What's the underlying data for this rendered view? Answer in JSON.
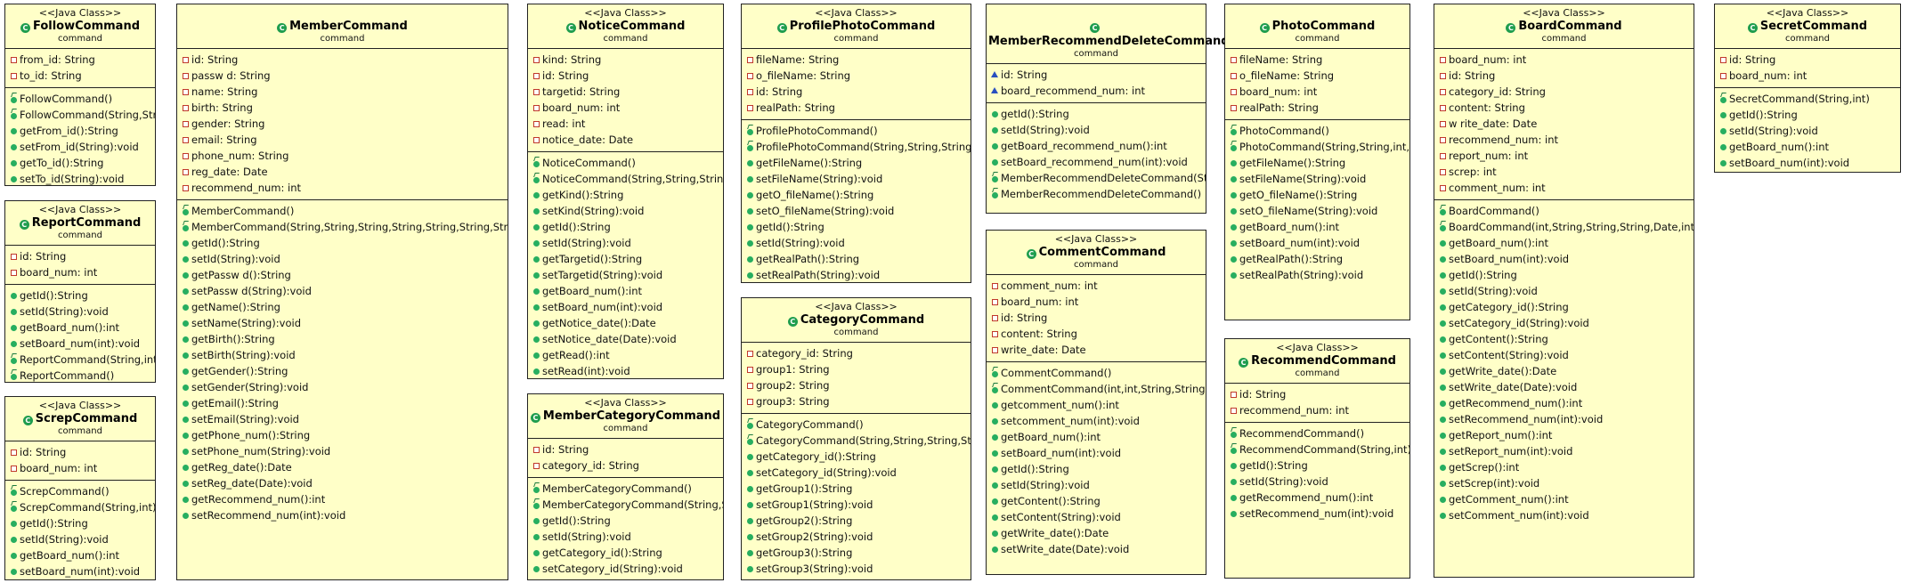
{
  "classes": [
    {
      "id": "follow",
      "stereotype": "<<Java Class>>",
      "name": "FollowCommand",
      "package": "command",
      "attributes": [
        {
          "text": "from_id: String",
          "vis": "private"
        },
        {
          "text": "to_id: String",
          "vis": "private"
        }
      ],
      "methods": [
        {
          "text": "FollowCommand()",
          "kind": "ctor"
        },
        {
          "text": "FollowCommand(String,String)",
          "kind": "ctor"
        },
        {
          "text": "getFrom_id():String",
          "kind": "public"
        },
        {
          "text": "setFrom_id(String):void",
          "kind": "public"
        },
        {
          "text": "getTo_id():String",
          "kind": "public"
        },
        {
          "text": "setTo_id(String):void",
          "kind": "public"
        }
      ]
    },
    {
      "id": "report",
      "stereotype": "<<Java Class>>",
      "name": "ReportCommand",
      "package": "command",
      "attributes": [
        {
          "text": "id: String",
          "vis": "private"
        },
        {
          "text": "board_num: int",
          "vis": "private"
        }
      ],
      "methods": [
        {
          "text": "getId():String",
          "kind": "public"
        },
        {
          "text": "setId(String):void",
          "kind": "public"
        },
        {
          "text": "getBoard_num():int",
          "kind": "public"
        },
        {
          "text": "setBoard_num(int):void",
          "kind": "public"
        },
        {
          "text": "ReportCommand(String,int)",
          "kind": "ctor"
        },
        {
          "text": "ReportCommand()",
          "kind": "ctor"
        }
      ]
    },
    {
      "id": "screp",
      "stereotype": "<<Java Class>>",
      "name": "ScrepCommand",
      "package": "command",
      "attributes": [
        {
          "text": "id: String",
          "vis": "private"
        },
        {
          "text": "board_num: int",
          "vis": "private"
        }
      ],
      "methods": [
        {
          "text": "ScrepCommand()",
          "kind": "ctor"
        },
        {
          "text": "ScrepCommand(String,int)",
          "kind": "ctor"
        },
        {
          "text": "getId():String",
          "kind": "public"
        },
        {
          "text": "setId(String):void",
          "kind": "public"
        },
        {
          "text": "getBoard_num():int",
          "kind": "public"
        },
        {
          "text": "setBoard_num(int):void",
          "kind": "public"
        }
      ]
    },
    {
      "id": "member",
      "stereotype": "",
      "name": "MemberCommand",
      "package": "command",
      "attributes": [
        {
          "text": "id: String",
          "vis": "private"
        },
        {
          "text": "passw d: String",
          "vis": "private"
        },
        {
          "text": "name: String",
          "vis": "private"
        },
        {
          "text": "birth: String",
          "vis": "private"
        },
        {
          "text": "gender: String",
          "vis": "private"
        },
        {
          "text": "email: String",
          "vis": "private"
        },
        {
          "text": "phone_num: String",
          "vis": "private"
        },
        {
          "text": "reg_date: Date",
          "vis": "private"
        },
        {
          "text": "recommend_num: int",
          "vis": "private"
        }
      ],
      "methods": [
        {
          "text": "MemberCommand()",
          "kind": "ctor"
        },
        {
          "text": "MemberCommand(String,String,String,String,String,String,String,Date,int)",
          "kind": "ctor"
        },
        {
          "text": "getId():String",
          "kind": "public"
        },
        {
          "text": "setId(String):void",
          "kind": "public"
        },
        {
          "text": "getPassw d():String",
          "kind": "public"
        },
        {
          "text": "setPassw d(String):void",
          "kind": "public"
        },
        {
          "text": "getName():String",
          "kind": "public"
        },
        {
          "text": "setName(String):void",
          "kind": "public"
        },
        {
          "text": "getBirth():String",
          "kind": "public"
        },
        {
          "text": "setBirth(String):void",
          "kind": "public"
        },
        {
          "text": "getGender():String",
          "kind": "public"
        },
        {
          "text": "setGender(String):void",
          "kind": "public"
        },
        {
          "text": "getEmail():String",
          "kind": "public"
        },
        {
          "text": "setEmail(String):void",
          "kind": "public"
        },
        {
          "text": "getPhone_num():String",
          "kind": "public"
        },
        {
          "text": "setPhone_num(String):void",
          "kind": "public"
        },
        {
          "text": "getReg_date():Date",
          "kind": "public"
        },
        {
          "text": "setReg_date(Date):void",
          "kind": "public"
        },
        {
          "text": "getRecommend_num():int",
          "kind": "public"
        },
        {
          "text": "setRecommend_num(int):void",
          "kind": "public"
        }
      ]
    },
    {
      "id": "notice",
      "stereotype": "<<Java Class>>",
      "name": "NoticeCommand",
      "package": "command",
      "attributes": [
        {
          "text": "kind: String",
          "vis": "private"
        },
        {
          "text": "id: String",
          "vis": "private"
        },
        {
          "text": "targetid: String",
          "vis": "private"
        },
        {
          "text": "board_num: int",
          "vis": "private"
        },
        {
          "text": "read: int",
          "vis": "private"
        },
        {
          "text": "notice_date: Date",
          "vis": "private"
        }
      ],
      "methods": [
        {
          "text": "NoticeCommand()",
          "kind": "ctor"
        },
        {
          "text": "NoticeCommand(String,String,String,int)",
          "kind": "ctor"
        },
        {
          "text": "getKind():String",
          "kind": "public"
        },
        {
          "text": "setKind(String):void",
          "kind": "public"
        },
        {
          "text": "getId():String",
          "kind": "public"
        },
        {
          "text": "setId(String):void",
          "kind": "public"
        },
        {
          "text": "getTargetid():String",
          "kind": "public"
        },
        {
          "text": "setTargetid(String):void",
          "kind": "public"
        },
        {
          "text": "getBoard_num():int",
          "kind": "public"
        },
        {
          "text": "setBoard_num(int):void",
          "kind": "public"
        },
        {
          "text": "getNotice_date():Date",
          "kind": "public"
        },
        {
          "text": "setNotice_date(Date):void",
          "kind": "public"
        },
        {
          "text": "getRead():int",
          "kind": "public"
        },
        {
          "text": "setRead(int):void",
          "kind": "public"
        }
      ]
    },
    {
      "id": "membercategory",
      "stereotype": "<<Java Class>>",
      "name": "MemberCategoryCommand",
      "package": "command",
      "attributes": [
        {
          "text": "id: String",
          "vis": "private"
        },
        {
          "text": "category_id: String",
          "vis": "private"
        }
      ],
      "methods": [
        {
          "text": "MemberCategoryCommand()",
          "kind": "ctor"
        },
        {
          "text": "MemberCategoryCommand(String,String)",
          "kind": "ctor"
        },
        {
          "text": "getId():String",
          "kind": "public"
        },
        {
          "text": "setId(String):void",
          "kind": "public"
        },
        {
          "text": "getCategory_id():String",
          "kind": "public"
        },
        {
          "text": "setCategory_id(String):void",
          "kind": "public"
        }
      ]
    },
    {
      "id": "profilephoto",
      "stereotype": "<<Java Class>>",
      "name": "ProfilePhotoCommand",
      "package": "command",
      "attributes": [
        {
          "text": "fileName: String",
          "vis": "private"
        },
        {
          "text": "o_fileName: String",
          "vis": "private"
        },
        {
          "text": "id: String",
          "vis": "private"
        },
        {
          "text": "realPath: String",
          "vis": "private"
        }
      ],
      "methods": [
        {
          "text": "ProfilePhotoCommand()",
          "kind": "ctor"
        },
        {
          "text": "ProfilePhotoCommand(String,String,String,String)",
          "kind": "ctor"
        },
        {
          "text": "getFileName():String",
          "kind": "public"
        },
        {
          "text": "setFileName(String):void",
          "kind": "public"
        },
        {
          "text": "getO_fileName():String",
          "kind": "public"
        },
        {
          "text": "setO_fileName(String):void",
          "kind": "public"
        },
        {
          "text": "getId():String",
          "kind": "public"
        },
        {
          "text": "setId(String):void",
          "kind": "public"
        },
        {
          "text": "getRealPath():String",
          "kind": "public"
        },
        {
          "text": "setRealPath(String):void",
          "kind": "public"
        }
      ]
    },
    {
      "id": "category",
      "stereotype": "<<Java Class>>",
      "name": "CategoryCommand",
      "package": "command",
      "attributes": [
        {
          "text": "category_id: String",
          "vis": "private"
        },
        {
          "text": "group1: String",
          "vis": "private"
        },
        {
          "text": "group2: String",
          "vis": "private"
        },
        {
          "text": "group3: String",
          "vis": "private"
        }
      ],
      "methods": [
        {
          "text": "CategoryCommand()",
          "kind": "ctor"
        },
        {
          "text": "CategoryCommand(String,String,String,String)",
          "kind": "ctor"
        },
        {
          "text": "getCategory_id():String",
          "kind": "public"
        },
        {
          "text": "setCategory_id(String):void",
          "kind": "public"
        },
        {
          "text": "getGroup1():String",
          "kind": "public"
        },
        {
          "text": "setGroup1(String):void",
          "kind": "public"
        },
        {
          "text": "getGroup2():String",
          "kind": "public"
        },
        {
          "text": "setGroup2(String):void",
          "kind": "public"
        },
        {
          "text": "getGroup3():String",
          "kind": "public"
        },
        {
          "text": "setGroup3(String):void",
          "kind": "public"
        }
      ]
    },
    {
      "id": "memberrecommenddelete",
      "stereotype": "",
      "name": "MemberRecommendDeleteCommand",
      "package": "command",
      "attributes": [
        {
          "text": "id: String",
          "vis": "package"
        },
        {
          "text": "board_recommend_num: int",
          "vis": "package"
        }
      ],
      "methods": [
        {
          "text": "getId():String",
          "kind": "public"
        },
        {
          "text": "setId(String):void",
          "kind": "public"
        },
        {
          "text": "getBoard_recommend_num():int",
          "kind": "public"
        },
        {
          "text": "setBoard_recommend_num(int):void",
          "kind": "public"
        },
        {
          "text": "MemberRecommendDeleteCommand(String,int)",
          "kind": "ctor"
        },
        {
          "text": "MemberRecommendDeleteCommand()",
          "kind": "ctor"
        }
      ]
    },
    {
      "id": "comment",
      "stereotype": "<<Java Class>>",
      "name": "CommentCommand",
      "package": "command",
      "attributes": [
        {
          "text": "comment_num: int",
          "vis": "private"
        },
        {
          "text": "board_num: int",
          "vis": "private"
        },
        {
          "text": "id: String",
          "vis": "private"
        },
        {
          "text": "content: String",
          "vis": "private"
        },
        {
          "text": "write_date: Date",
          "vis": "private"
        }
      ],
      "methods": [
        {
          "text": "CommentCommand()",
          "kind": "ctor"
        },
        {
          "text": "CommentCommand(int,int,String,String,Date)",
          "kind": "ctor"
        },
        {
          "text": "getcomment_num():int",
          "kind": "public"
        },
        {
          "text": "setcomment_num(int):void",
          "kind": "public"
        },
        {
          "text": "getBoard_num():int",
          "kind": "public"
        },
        {
          "text": "setBoard_num(int):void",
          "kind": "public"
        },
        {
          "text": "getId():String",
          "kind": "public"
        },
        {
          "text": "setId(String):void",
          "kind": "public"
        },
        {
          "text": "getContent():String",
          "kind": "public"
        },
        {
          "text": "setContent(String):void",
          "kind": "public"
        },
        {
          "text": "getWrite_date():Date",
          "kind": "public"
        },
        {
          "text": "setWrite_date(Date):void",
          "kind": "public"
        }
      ]
    },
    {
      "id": "photo",
      "stereotype": "",
      "name": "PhotoCommand",
      "package": "command",
      "attributes": [
        {
          "text": "fileName: String",
          "vis": "private"
        },
        {
          "text": "o_fileName: String",
          "vis": "private"
        },
        {
          "text": "board_num: int",
          "vis": "private"
        },
        {
          "text": "realPath: String",
          "vis": "private"
        }
      ],
      "methods": [
        {
          "text": "PhotoCommand()",
          "kind": "ctor"
        },
        {
          "text": "PhotoCommand(String,String,int,String)",
          "kind": "ctor"
        },
        {
          "text": "getFileName():String",
          "kind": "public"
        },
        {
          "text": "setFileName(String):void",
          "kind": "public"
        },
        {
          "text": "getO_fileName():String",
          "kind": "public"
        },
        {
          "text": "setO_fileName(String):void",
          "kind": "public"
        },
        {
          "text": "getBoard_num():int",
          "kind": "public"
        },
        {
          "text": "setBoard_num(int):void",
          "kind": "public"
        },
        {
          "text": "getRealPath():String",
          "kind": "public"
        },
        {
          "text": "setRealPath(String):void",
          "kind": "public"
        }
      ]
    },
    {
      "id": "recommend",
      "stereotype": "<<Java Class>>",
      "name": "RecommendCommand",
      "package": "command",
      "attributes": [
        {
          "text": "id: String",
          "vis": "private"
        },
        {
          "text": "recommend_num: int",
          "vis": "private"
        }
      ],
      "methods": [
        {
          "text": "RecommendCommand()",
          "kind": "ctor"
        },
        {
          "text": "RecommendCommand(String,int)",
          "kind": "ctor"
        },
        {
          "text": "getId():String",
          "kind": "public"
        },
        {
          "text": "setId(String):void",
          "kind": "public"
        },
        {
          "text": "getRecommend_num():int",
          "kind": "public"
        },
        {
          "text": "setRecommend_num(int):void",
          "kind": "public"
        }
      ]
    },
    {
      "id": "board",
      "stereotype": "<<Java Class>>",
      "name": "BoardCommand",
      "package": "command",
      "attributes": [
        {
          "text": "board_num: int",
          "vis": "private"
        },
        {
          "text": "id: String",
          "vis": "private"
        },
        {
          "text": "category_id: String",
          "vis": "private"
        },
        {
          "text": "content: String",
          "vis": "private"
        },
        {
          "text": "w rite_date: Date",
          "vis": "private"
        },
        {
          "text": "recommend_num: int",
          "vis": "private"
        },
        {
          "text": "report_num: int",
          "vis": "private"
        },
        {
          "text": "screp: int",
          "vis": "private"
        },
        {
          "text": "comment_num: int",
          "vis": "private"
        }
      ],
      "methods": [
        {
          "text": "BoardCommand()",
          "kind": "ctor"
        },
        {
          "text": "BoardCommand(int,String,String,String,Date,int,int,int,int)",
          "kind": "ctor"
        },
        {
          "text": "getBoard_num():int",
          "kind": "public"
        },
        {
          "text": "setBoard_num(int):void",
          "kind": "public"
        },
        {
          "text": "getId():String",
          "kind": "public"
        },
        {
          "text": "setId(String):void",
          "kind": "public"
        },
        {
          "text": "getCategory_id():String",
          "kind": "public"
        },
        {
          "text": "setCategory_id(String):void",
          "kind": "public"
        },
        {
          "text": "getContent():String",
          "kind": "public"
        },
        {
          "text": "setContent(String):void",
          "kind": "public"
        },
        {
          "text": "getWrite_date():Date",
          "kind": "public"
        },
        {
          "text": "setWrite_date(Date):void",
          "kind": "public"
        },
        {
          "text": "getRecommend_num():int",
          "kind": "public"
        },
        {
          "text": "setRecommend_num(int):void",
          "kind": "public"
        },
        {
          "text": "getReport_num():int",
          "kind": "public"
        },
        {
          "text": "setReport_num(int):void",
          "kind": "public"
        },
        {
          "text": "getScrep():int",
          "kind": "public"
        },
        {
          "text": "setScrep(int):void",
          "kind": "public"
        },
        {
          "text": "getComment_num():int",
          "kind": "public"
        },
        {
          "text": "setComment_num(int):void",
          "kind": "public"
        }
      ]
    },
    {
      "id": "secret",
      "stereotype": "<<Java Class>>",
      "name": "SecretCommand",
      "package": "command",
      "attributes": [
        {
          "text": "id: String",
          "vis": "private"
        },
        {
          "text": "board_num: int",
          "vis": "private"
        }
      ],
      "methods": [
        {
          "text": "SecretCommand(String,int)",
          "kind": "ctor"
        },
        {
          "text": "getId():String",
          "kind": "public"
        },
        {
          "text": "setId(String):void",
          "kind": "public"
        },
        {
          "text": "getBoard_num():int",
          "kind": "public"
        },
        {
          "text": "setBoard_num(int):void",
          "kind": "public"
        }
      ]
    }
  ]
}
